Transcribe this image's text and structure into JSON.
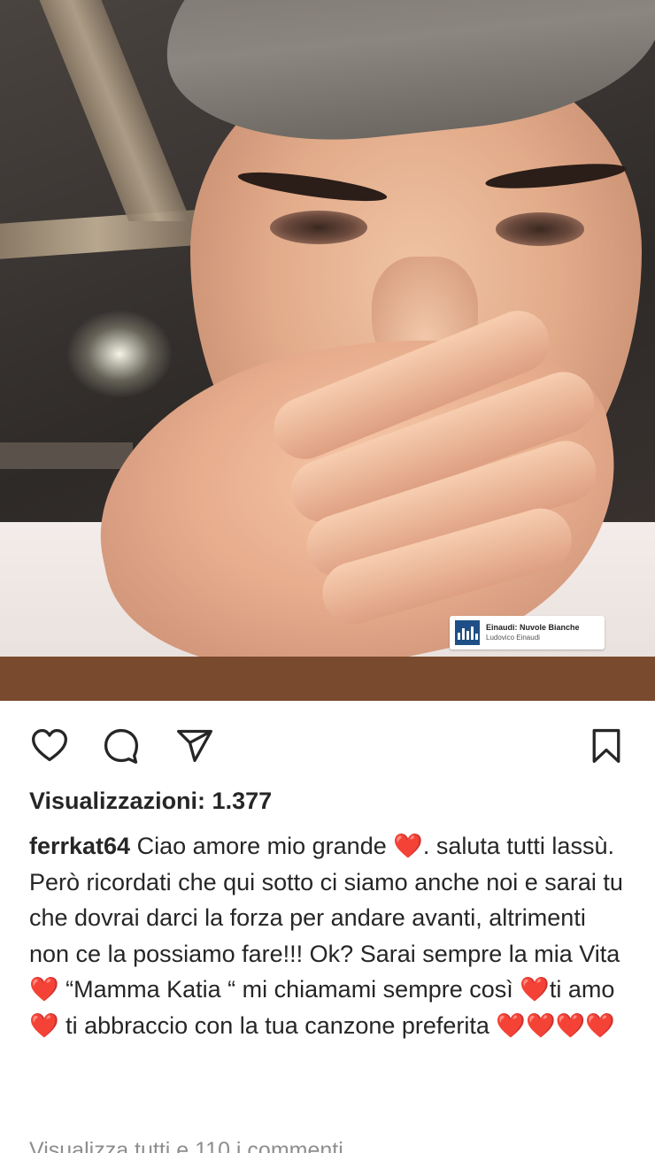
{
  "music": {
    "title": "Einaudi: Nuvole Bianche",
    "artist": "Ludovico Einaudi"
  },
  "actions": {
    "like_icon": "heart-outline-icon",
    "comment_icon": "comment-bubble-icon",
    "share_icon": "paper-plane-icon",
    "save_icon": "bookmark-icon"
  },
  "views": {
    "text": "Visualizzazioni: 1.377"
  },
  "caption": {
    "username": "ferrkat64",
    "seg1": " Ciao amore mio grande ",
    "seg2": ". saluta tutti lassù. Però ricordati che qui sotto ci siamo anche noi e sarai tu che dovrai darci la forza per andare avanti, altrimenti non ce la possiamo fare!!! Ok? Sarai sempre la mia Vita ",
    "seg3": " “Mamma Katia “ mi chiamami sempre così ",
    "seg4": "ti amo",
    "seg5": " ti abbraccio con la tua canzone preferita ",
    "heart": "❤️",
    "hearts_end": "❤️❤️❤️❤️"
  },
  "comments_link": {
    "text": "Visualizza tutti e 110 i commenti"
  },
  "colors": {
    "heart": "#e0242b",
    "text": "#262626",
    "muted": "#8e8e8e"
  }
}
